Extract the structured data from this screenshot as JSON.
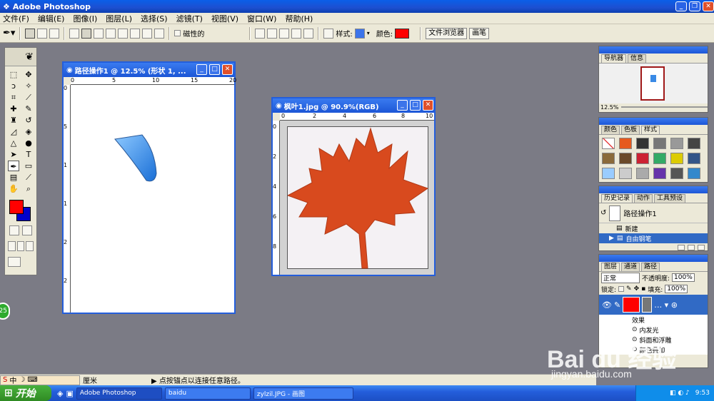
{
  "app": {
    "title": "Adobe Photoshop"
  },
  "menu": [
    "文件(F)",
    "编辑(E)",
    "图像(I)",
    "图层(L)",
    "选择(S)",
    "滤镜(T)",
    "视图(V)",
    "窗口(W)",
    "帮助(H)"
  ],
  "options": {
    "rubber_band": "磁性的",
    "style_label": "样式:",
    "color_label": "颜色:",
    "color": "#ff0000",
    "file_browser": "文件浏览器",
    "brushes": "画笔"
  },
  "doc1": {
    "title": "路径操作1 @ 12.5% (形状 1, ...",
    "ruler_top": [
      "0",
      "5",
      "10",
      "15",
      "20"
    ],
    "ruler_left": [
      "0",
      "5",
      "1",
      "1",
      "2",
      "2"
    ]
  },
  "doc2": {
    "title": "枫叶1.jpg @ 90.9%(RGB)",
    "ruler_top": [
      "0",
      "2",
      "4",
      "6",
      "8",
      "10"
    ],
    "ruler_left": [
      "0",
      "2",
      "4",
      "6",
      "8"
    ],
    "leaf_color": "#d84a1e"
  },
  "navigator": {
    "tabs": [
      "导航器",
      "信息"
    ],
    "zoom": "12.5%"
  },
  "styles": {
    "tabs": [
      "颜色",
      "色板",
      "样式"
    ]
  },
  "history": {
    "tabs": [
      "历史记录",
      "动作",
      "工具预设"
    ],
    "snapshot": "路径操作1",
    "items": [
      "新建",
      "自由钢笔"
    ]
  },
  "layers": {
    "tabs": [
      "图层",
      "通道",
      "路径"
    ],
    "mode": "正常",
    "opacity_label": "不透明度:",
    "opacity": "100%",
    "lock_label": "锁定:",
    "fill_label": "填充:",
    "fill": "100%",
    "effects": [
      "效果",
      "内发光",
      "斜面和浮雕",
      "颜色叠加"
    ]
  },
  "status": {
    "ime": "中",
    "unit": "厘米",
    "hint": "▶ 点按锚点以连接任意路径。"
  },
  "taskbar": {
    "start": "开始",
    "tasks": [
      "Adobe Photoshop",
      "baidu",
      "zylzil.JPG - 画图"
    ],
    "clock": "9:53"
  },
  "watermark": {
    "text": "Bai du 经验",
    "url": "jingyan.baidu.com"
  },
  "badge": "25"
}
